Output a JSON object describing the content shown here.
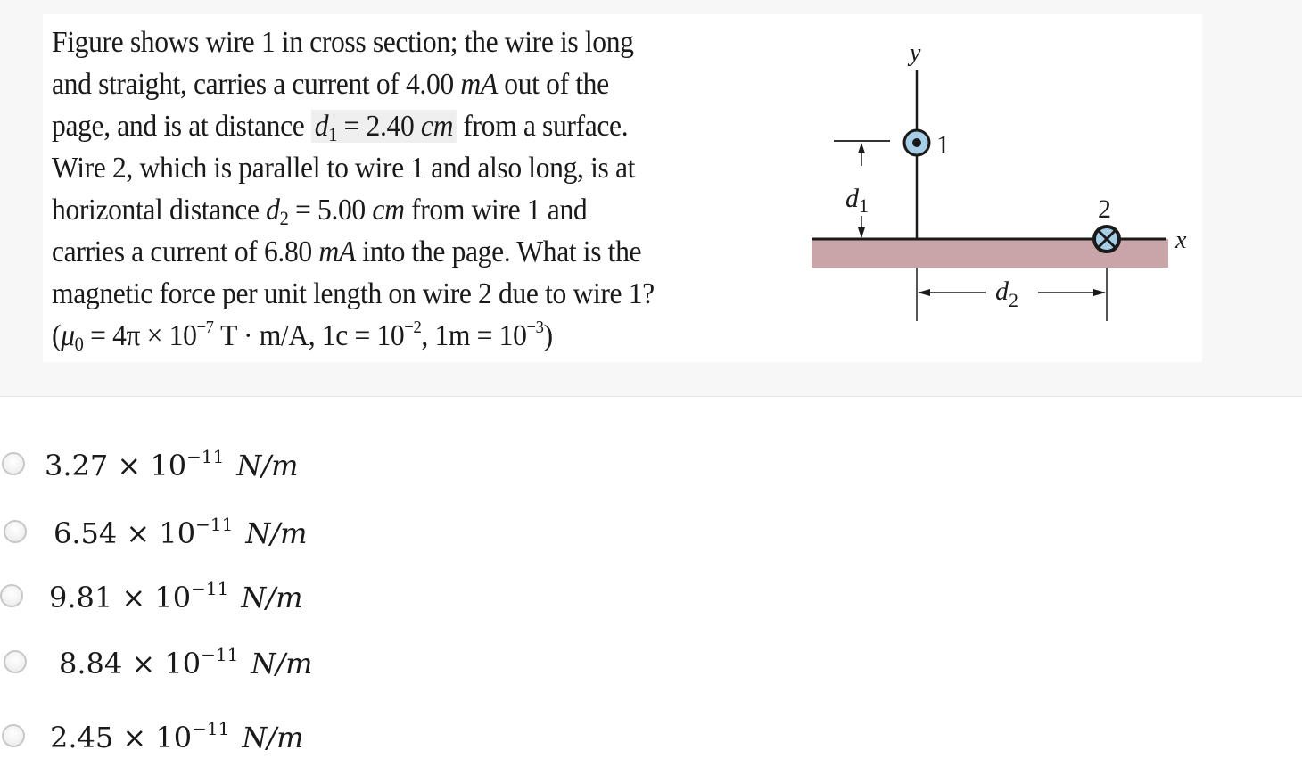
{
  "question": {
    "line1": "Figure shows wire 1 in cross section; the wire is long",
    "line2_pre": "and straight, carries a current of 4.00 ",
    "line2_unit": "mA",
    "line2_post": " out of the",
    "line3_pre": "page, and is at distance ",
    "line3_var": "d",
    "line3_sub": "1",
    "line3_eq": " = 2.40 ",
    "line3_unit": "cm",
    "line3_post": " from a surface.",
    "line4": "Wire 2, which is parallel to wire 1 and also long, is at",
    "line5_pre": "horizontal distance ",
    "line5_var": "d",
    "line5_sub": "2",
    "line5_eq": " = 5.00 ",
    "line5_unit": "cm",
    "line5_post": " from wire 1 and",
    "line6_pre": "carries a current of 6.80 ",
    "line6_unit": "mA",
    "line6_post": " into the page. What is the",
    "line7": "magnetic force per unit length on wire 2 due to wire 1?",
    "line8_a": "(",
    "line8_mu": "μ",
    "line8_mu_sub": "0",
    "line8_b": " = 4π × 10",
    "line8_exp1": "−7",
    "line8_c": " T · m/A, 1c = 10",
    "line8_exp2": "−2",
    "line8_d": ", 1m = 10",
    "line8_exp3": "−3",
    "line8_e": ")"
  },
  "figure": {
    "y_axis_label": "y",
    "x_axis_label": "x",
    "wire1_label": "1",
    "wire2_label": "2",
    "d1_label": "d",
    "d1_sub": "1",
    "d2_label": "d",
    "d2_sub": "2",
    "surface_color": "#c9a5a8",
    "wire_fill_color": "#a8cde6"
  },
  "options": [
    {
      "mantissa": "3.27",
      "times": " × 10",
      "exponent": "−11",
      "unit": "N/m"
    },
    {
      "mantissa": "6.54",
      "times": " × 10",
      "exponent": "−11",
      "unit": "N/m"
    },
    {
      "mantissa": "9.81",
      "times": " × 10",
      "exponent": "−11",
      "unit": "N/m"
    },
    {
      "mantissa": "8.84",
      "times": " × 10",
      "exponent": "−11",
      "unit": "N/m"
    },
    {
      "mantissa": "2.45",
      "times": " × 10",
      "exponent": "−11",
      "unit": "N/m"
    }
  ]
}
